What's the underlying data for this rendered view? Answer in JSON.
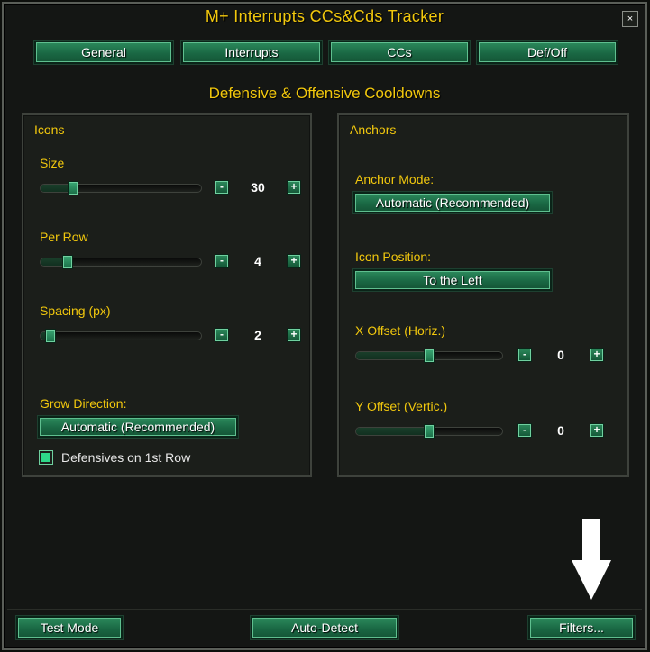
{
  "window": {
    "title": "M+ Interrupts CCs&Cds Tracker",
    "close_glyph": "×"
  },
  "tabs": [
    {
      "label": "General"
    },
    {
      "label": "Interrupts"
    },
    {
      "label": "CCs"
    },
    {
      "label": "Def/Off"
    }
  ],
  "section_title": "Defensive & Offensive Cooldowns",
  "icons_panel": {
    "header": "Icons",
    "size": {
      "label": "Size",
      "value": "30",
      "fraction": 0.2
    },
    "per_row": {
      "label": "Per Row",
      "value": "4",
      "fraction": 0.17
    },
    "spacing": {
      "label": "Spacing (px)",
      "value": "2",
      "fraction": 0.06
    },
    "grow_direction": {
      "label": "Grow Direction:",
      "button": "Automatic (Recommended)"
    },
    "defensives_first_row": {
      "label": "Defensives on 1st Row",
      "checked": true
    }
  },
  "anchors_panel": {
    "header": "Anchors",
    "anchor_mode": {
      "label": "Anchor Mode:",
      "button": "Automatic (Recommended)"
    },
    "icon_position": {
      "label": "Icon Position:",
      "button": "To the Left"
    },
    "x_offset": {
      "label": "X Offset (Horiz.)",
      "value": "0",
      "fraction": 0.5
    },
    "y_offset": {
      "label": "Y Offset (Vertic.)",
      "value": "0",
      "fraction": 0.5
    }
  },
  "stepper": {
    "minus": "-",
    "plus": "+"
  },
  "footer": {
    "test_mode": "Test Mode",
    "auto_detect": "Auto-Detect",
    "filters": "Filters..."
  },
  "colors": {
    "gold": "#f2c80d",
    "button_green": "#1a6844",
    "check_green": "#2ed889"
  }
}
